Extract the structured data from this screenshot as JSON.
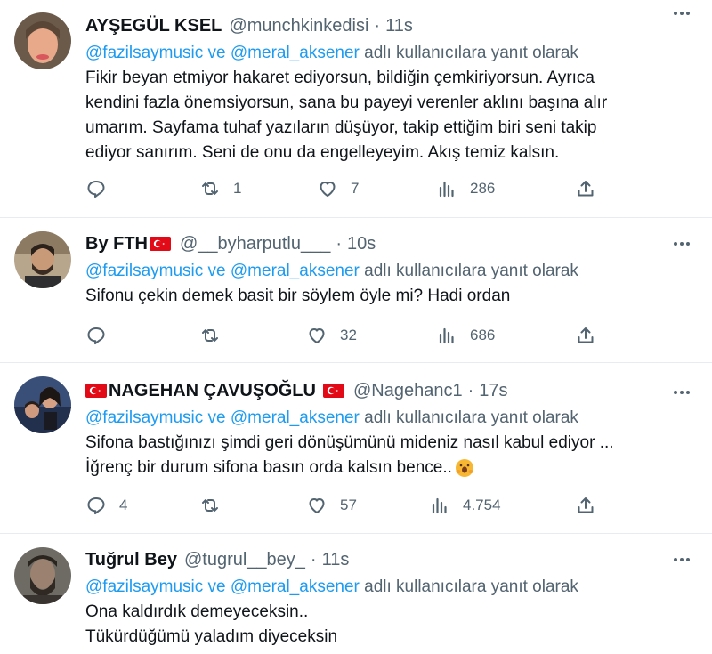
{
  "colors": {
    "mention": "#1d9bf0",
    "secondary": "#536471",
    "text": "#0f1419",
    "divider": "#e6ecf0"
  },
  "icons": [
    "more-icon",
    "reply-icon",
    "retweet-icon",
    "like-icon",
    "views-icon",
    "share-icon",
    "turkey-flag-icon",
    "emoji-icon"
  ],
  "tweets": [
    {
      "name": "AYŞEGÜL KSEL",
      "handle": "@munchkinkedisi",
      "sep": "·",
      "time": "11s",
      "reply_mentions": "@fazilsaymusic ve @meral_aksener",
      "reply_suffix": " adlı kullanıcılara yanıt olarak",
      "lines": [
        "Fikir beyan etmiyor hakaret ediyorsun, bildiğin çemkiriyorsun. Ayrıca",
        "kendini fazla önemsiyorsun, sana bu payeyi verenler aklını başına alır",
        "umarım. Sayfama tuhaf yazıların düşüyor, takip ettiğim biri seni takip",
        "ediyor sanırım. Seni de onu da engelleyeyim. Akış temiz kalsın."
      ],
      "stats": {
        "replies": "",
        "retweets": "1",
        "likes": "7",
        "views": "286"
      }
    },
    {
      "name": "By FTH",
      "handle": "@__byharputlu___",
      "sep": "·",
      "time": "10s",
      "reply_mentions": "@fazilsaymusic ve @meral_aksener",
      "reply_suffix": " adlı kullanıcılara yanıt olarak",
      "lines": [
        "Sifonu çekin demek basit bir söylem öyle mi? Hadi ordan"
      ],
      "stats": {
        "replies": "",
        "retweets": "",
        "likes": "32",
        "views": "686"
      }
    },
    {
      "name": "NAGEHAN ÇAVUŞOĞLU",
      "handle": "@Nagehanc1",
      "sep": "·",
      "time": "17s",
      "reply_mentions": "@fazilsaymusic ve @meral_aksener",
      "reply_suffix": " adlı kullanıcılara yanıt olarak",
      "lines": [
        "Sifona bastığınızı şimdi geri dönüşümünü mideniz nasıl kabul ediyor ...",
        "İğrenç bir durum sifona basın orda kalsın bence.."
      ],
      "stats": {
        "replies": "4",
        "retweets": "",
        "likes": "57",
        "views": "4.754"
      }
    },
    {
      "name": "Tuğrul Bey",
      "handle": "@tugrul__bey_",
      "sep": "·",
      "time": "11s",
      "reply_mentions": "@fazilsaymusic ve @meral_aksener",
      "reply_suffix": " adlı kullanıcılara yanıt olarak",
      "lines": [
        "Ona kaldırdık demeyeceksin..",
        "Tükürdüğümü yaladım diyeceksin"
      ]
    }
  ]
}
